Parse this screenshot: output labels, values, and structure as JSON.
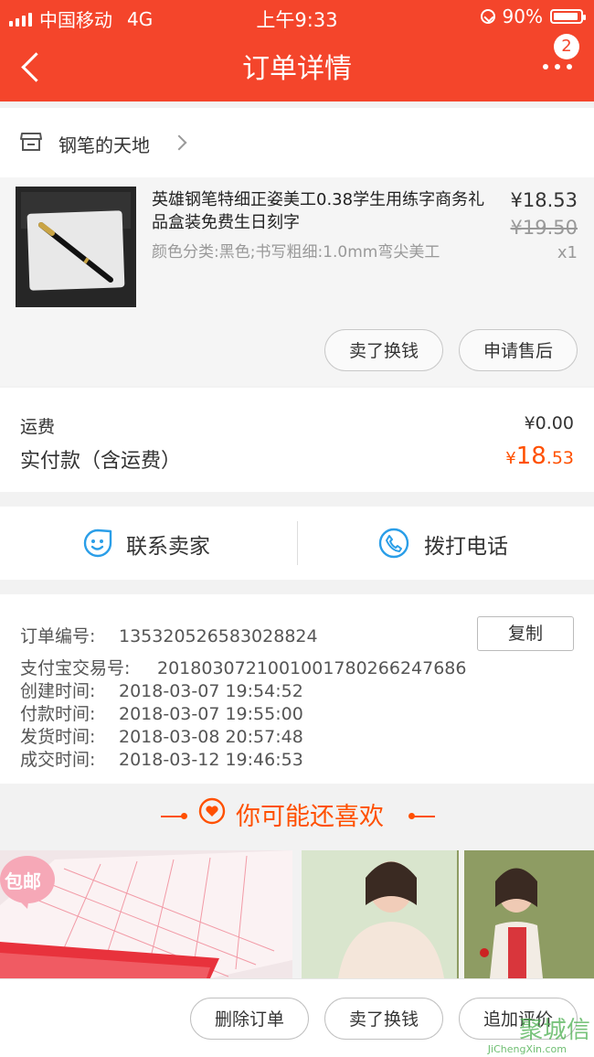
{
  "status": {
    "carrier": "中国移动",
    "network": "4G",
    "time": "上午9:33",
    "battery": "90%"
  },
  "header": {
    "title": "订单详情",
    "badge": "2"
  },
  "shop": {
    "name": "钢笔的天地"
  },
  "product": {
    "title": "英雄钢笔特细正姿美工0.38学生用练字商务礼品盒装免费生日刻字",
    "spec": "颜色分类:黑色;书写粗细:1.0mm弯尖美工",
    "price": "¥18.53",
    "old_price": "¥19.50",
    "qty": "x1",
    "actions": [
      "卖了换钱",
      "申请售后"
    ]
  },
  "fee": {
    "shipping_label": "运费",
    "shipping_value": "¥0.00",
    "paid_label": "实付款（含运费）",
    "paid_currency": "¥",
    "paid_int": "18",
    "paid_dec": ".53"
  },
  "contact": {
    "seller": "联系卖家",
    "call": "拨打电话"
  },
  "order": {
    "no_label": "订单编号:",
    "no_value": "1353205265830288​24",
    "copy": "复制",
    "alipay_label": "支付宝交易号:",
    "alipay_value": "2018030721001001780266247686",
    "created_label": "创建时间:",
    "created_value": "2018-03-07 19:54:52",
    "paid_label": "付款时间:",
    "paid_value": "2018-03-07 19:55:00",
    "shipped_label": "发货时间:",
    "shipped_value": "2018-03-08 20:57:48",
    "done_label": "成交时间:",
    "done_value": "2018-03-12 19:46:53"
  },
  "recommend": {
    "title": "你可能还喜欢",
    "tag": "包邮"
  },
  "bottom": {
    "delete": "删除订单",
    "resell": "卖了换钱",
    "review": "追加评价"
  },
  "watermark": {
    "text": "聚城信",
    "url": "JiChengXin.com"
  },
  "colors": {
    "brand": "#f4452b",
    "accent": "#ff5000",
    "link": "#2a9ee8"
  }
}
